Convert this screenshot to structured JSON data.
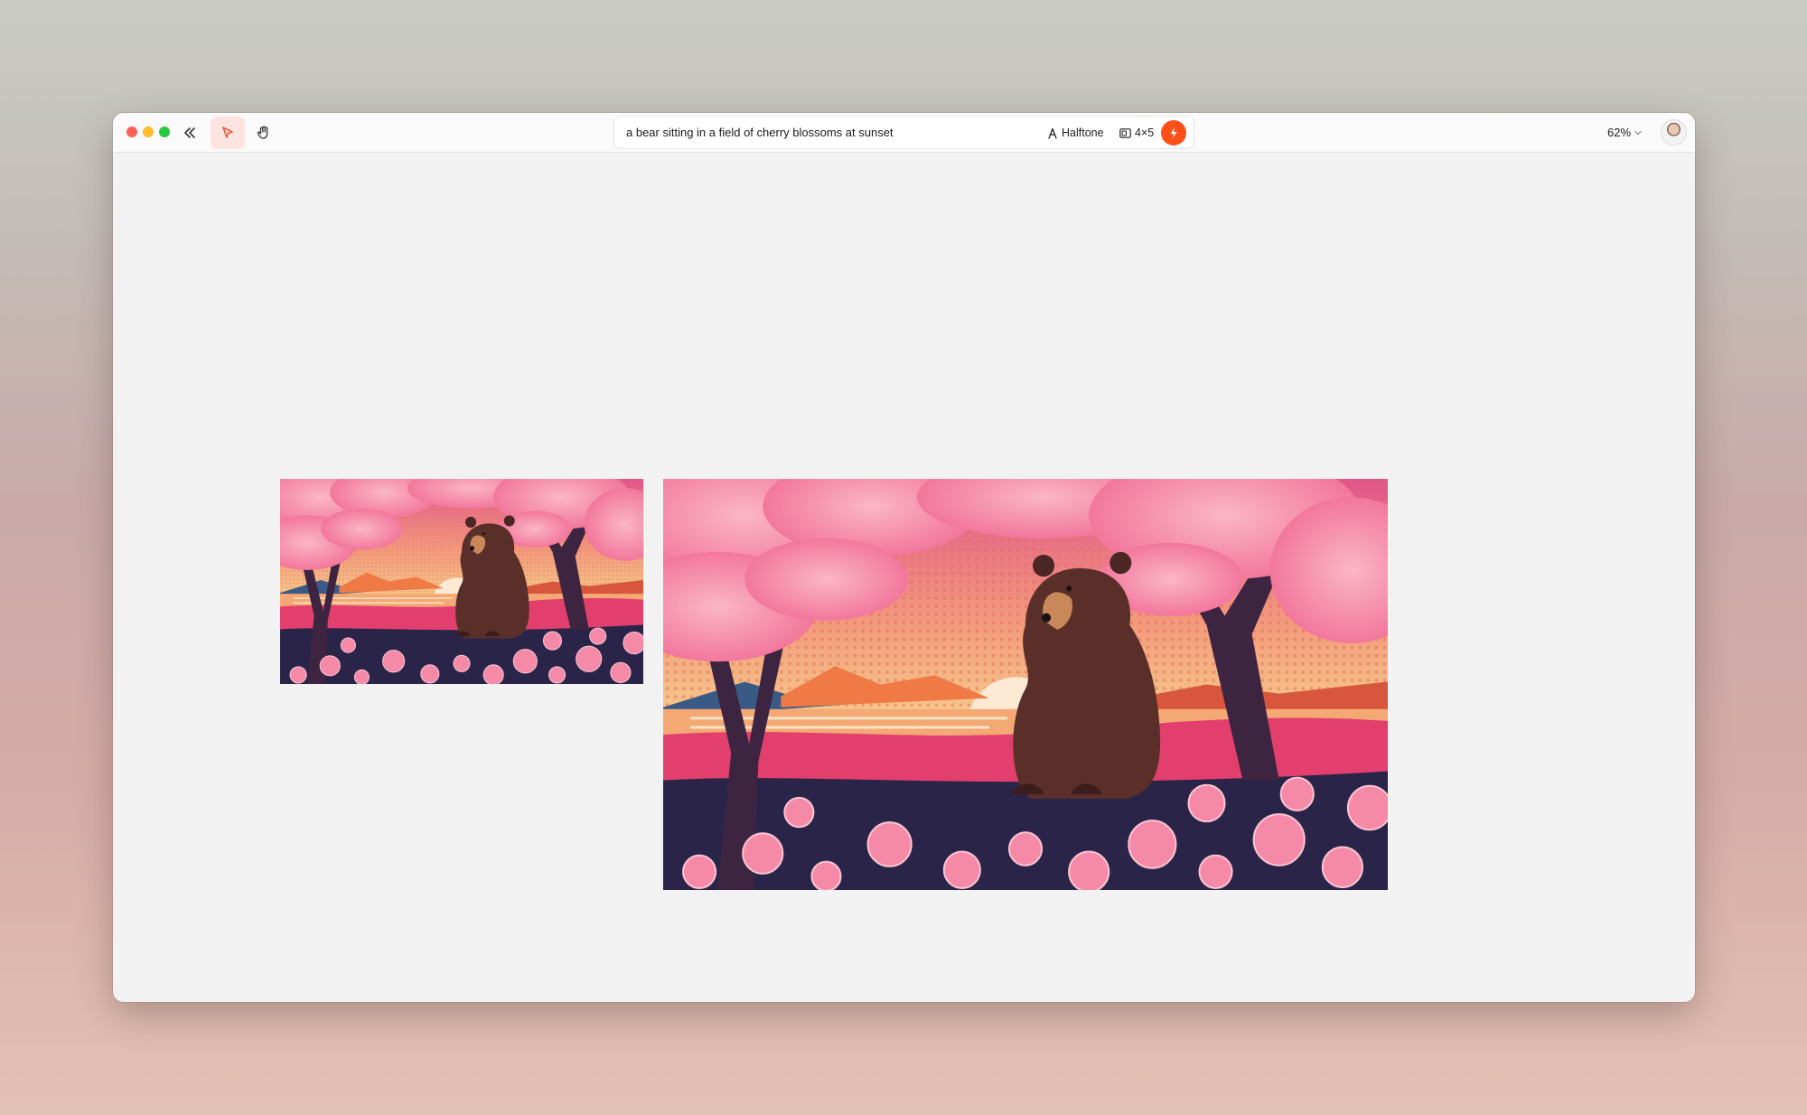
{
  "window": {
    "traffic_lights": [
      "close",
      "minimize",
      "zoom"
    ]
  },
  "toolbar": {
    "collapse_icon": "chevrons-left-icon",
    "select_icon": "cursor-arrow-icon",
    "hand_icon": "hand-icon",
    "accent_color": "#ff4f18"
  },
  "prompt": {
    "text": "a bear sitting in a field of cherry blossoms at sunset",
    "style_label": "Halftone",
    "ratio_label": "4×5",
    "generate_icon": "lightning-icon"
  },
  "view": {
    "zoom_label": "62%"
  },
  "canvas": {
    "images": [
      {
        "subject": "bear in cherry blossom field at sunset"
      },
      {
        "subject": "bear in cherry blossom field at sunset"
      }
    ]
  }
}
